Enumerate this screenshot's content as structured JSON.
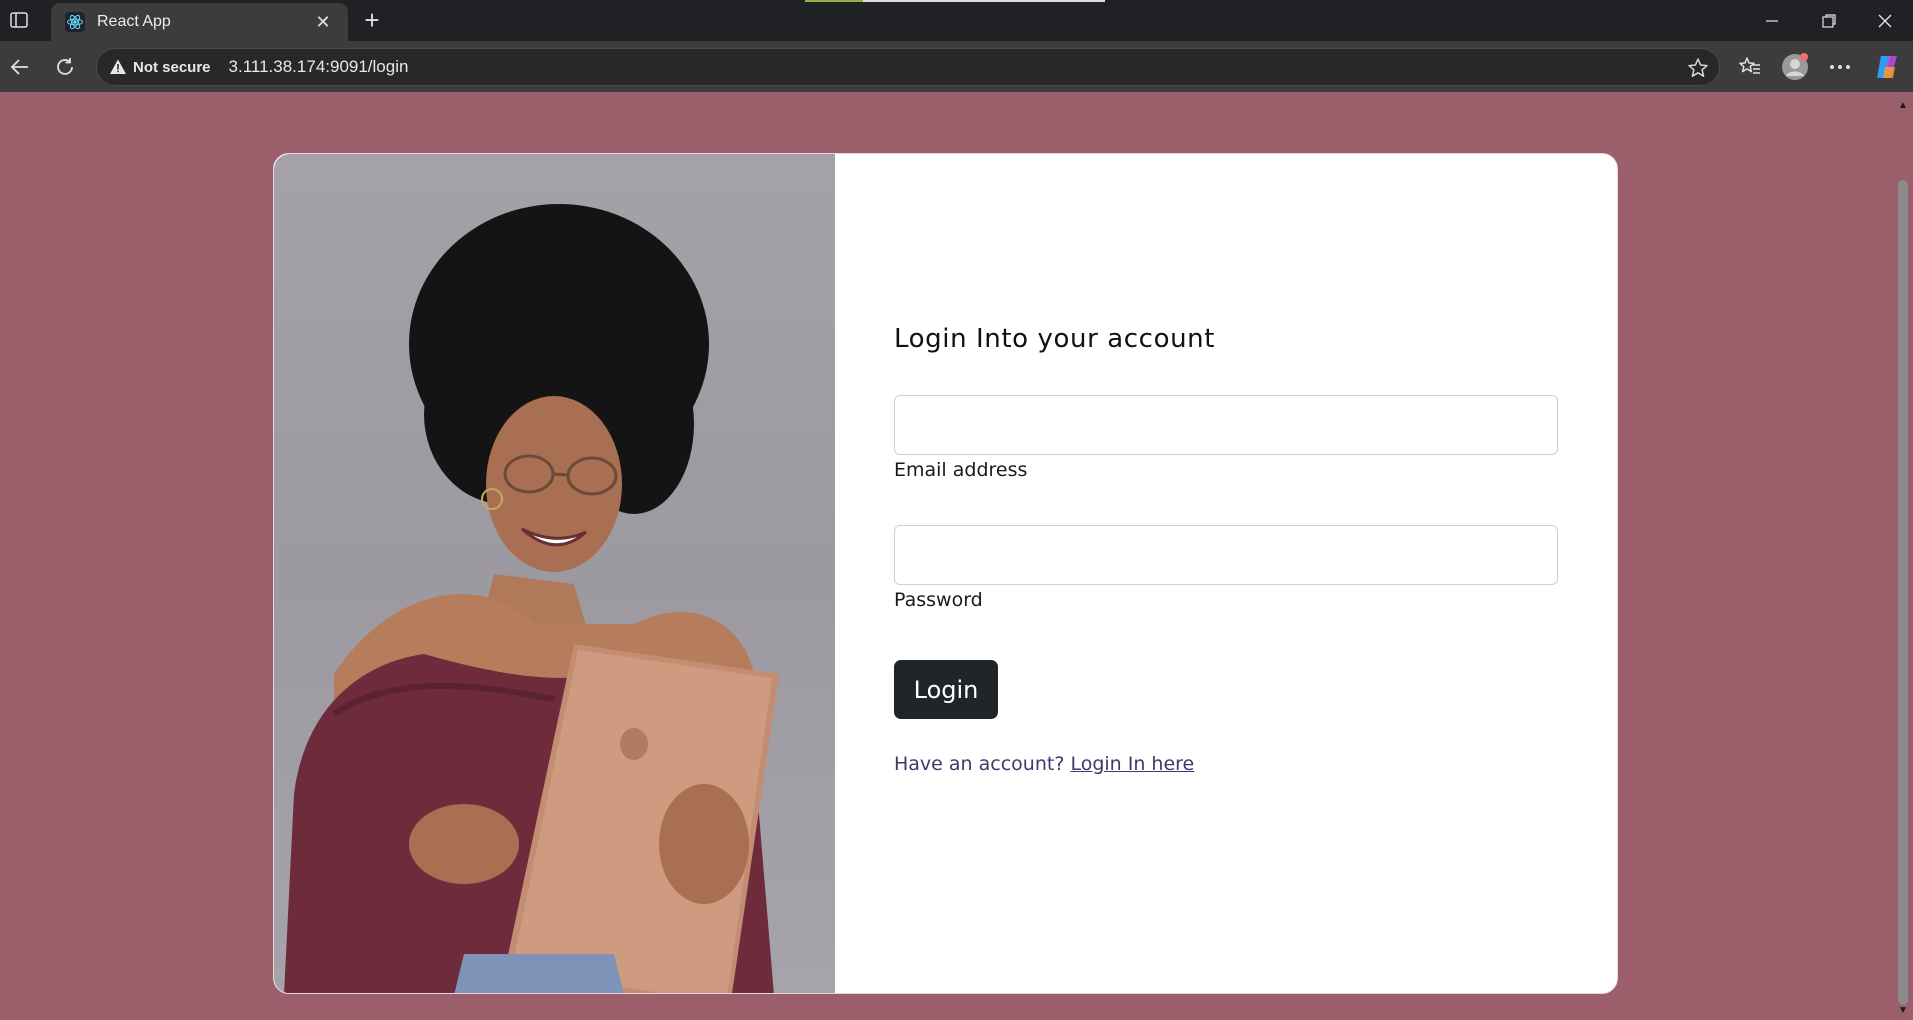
{
  "browser": {
    "tab_title": "React App",
    "security_label": "Not secure",
    "url": "3.111.38.174:9091/login"
  },
  "login": {
    "title": "Login Into your account",
    "email_label": "Email address",
    "email_value": "",
    "password_label": "Password",
    "password_value": "",
    "button_label": "Login",
    "prompt_text": "Have an account? ",
    "link_text": "Login In here"
  },
  "colors": {
    "page_background": "#9b5f6b",
    "button_background": "#212529",
    "link_color": "#3b3b6e"
  },
  "icons": {
    "favicon": "react-logo-icon",
    "photo": "woman-with-tablet-photo"
  }
}
